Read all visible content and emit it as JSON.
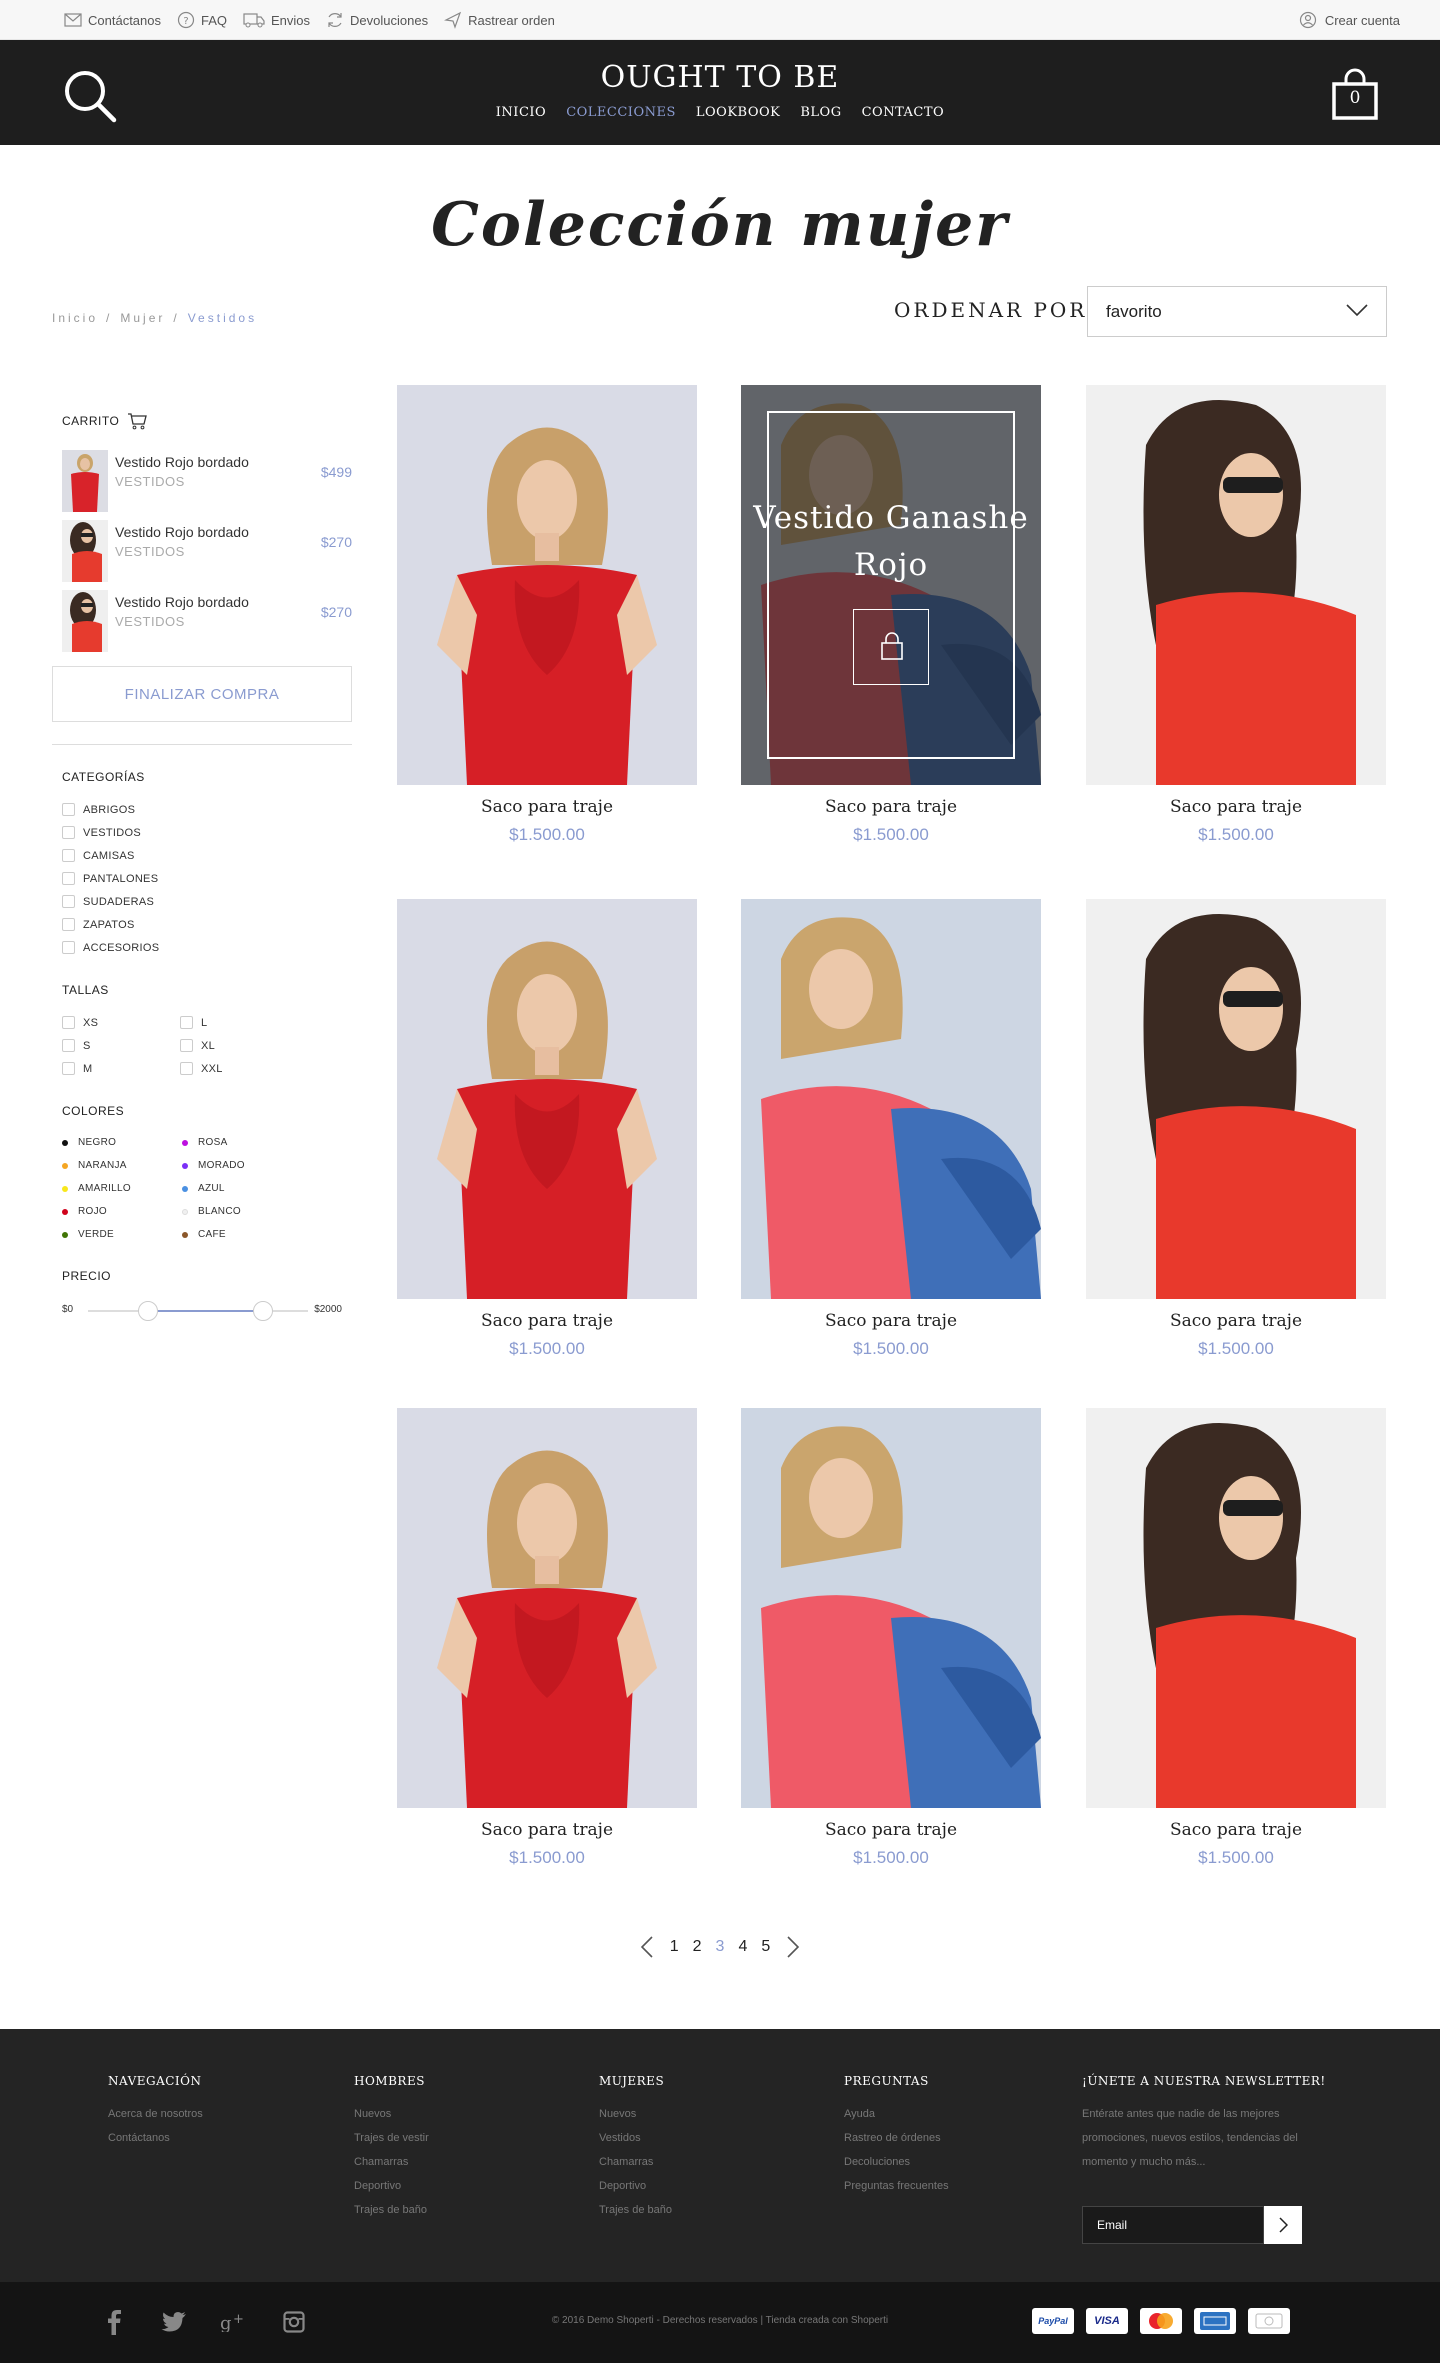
{
  "utilbar": {
    "links": [
      {
        "label": "Contáctanos",
        "icon": "mail-icon"
      },
      {
        "label": "FAQ",
        "icon": "help-icon"
      },
      {
        "label": "Envios",
        "icon": "truck-icon"
      },
      {
        "label": "Devoluciones",
        "icon": "refresh-icon"
      },
      {
        "label": "Rastrear orden",
        "icon": "send-icon"
      }
    ],
    "account_label": "Crear cuenta"
  },
  "header": {
    "logo": "OUGHT TO BE",
    "nav": [
      "INICIO",
      "COLECCIONES",
      "LOOKBOOK",
      "BLOG",
      "CONTACTO"
    ],
    "active_nav": "COLECCIONES",
    "cart_count": "0"
  },
  "page": {
    "title": "Colección mujer",
    "breadcrumb": [
      "Inicio",
      "/",
      "Mujer",
      "/",
      "Vestidos"
    ],
    "sort_label": "ORDENAR POR",
    "sort_value": "favorito"
  },
  "sidebar": {
    "cart_title": "CARRITO",
    "cart_items": [
      {
        "name": "Vestido Rojo bordado",
        "category": "VESTIDOS",
        "price": "$499"
      },
      {
        "name": "Vestido Rojo bordado",
        "category": "VESTIDOS",
        "price": "$270"
      },
      {
        "name": "Vestido Rojo bordado",
        "category": "VESTIDOS",
        "price": "$270"
      }
    ],
    "checkout_label": "FINALIZAR COMPRA",
    "categories_title": "CATEGORÍAS",
    "categories": [
      "ABRIGOS",
      "VESTIDOS",
      "CAMISAS",
      "PANTALONES",
      "SUDADERAS",
      "ZAPATOS",
      "ACCESORIOS"
    ],
    "sizes_title": "TALLAS",
    "sizes": [
      "XS",
      "S",
      "M",
      "L",
      "XL",
      "XXL"
    ],
    "colors_title": "COLORES",
    "colors": [
      {
        "name": "NEGRO",
        "hex": "#111111"
      },
      {
        "name": "NARANJA",
        "hex": "#f5a623"
      },
      {
        "name": "AMARILLO",
        "hex": "#f8e71c"
      },
      {
        "name": "ROJO",
        "hex": "#d0021b"
      },
      {
        "name": "VERDE",
        "hex": "#417505"
      },
      {
        "name": "ROSA",
        "hex": "#bd10e0"
      },
      {
        "name": "MORADO",
        "hex": "#7b2ff7"
      },
      {
        "name": "AZUL",
        "hex": "#4a90e2"
      },
      {
        "name": "BLANCO",
        "hex": "#eeeeee"
      },
      {
        "name": "CAFE",
        "hex": "#8b572a"
      }
    ],
    "price_title": "PRECIO",
    "price_min": "$0",
    "price_max": "$2000"
  },
  "products": [
    {
      "name": "Saco para traje",
      "price": "$1.500.00",
      "style": "red-dress"
    },
    {
      "name": "Saco para traje",
      "price": "$1.500.00",
      "style": "pink-jeans",
      "overlay_title": "Vestido Ganashe Rojo"
    },
    {
      "name": "Saco para traje",
      "price": "$1.500.00",
      "style": "red-blouse"
    },
    {
      "name": "Saco para traje",
      "price": "$1.500.00",
      "style": "red-dress"
    },
    {
      "name": "Saco para traje",
      "price": "$1.500.00",
      "style": "pink-jeans"
    },
    {
      "name": "Saco para traje",
      "price": "$1.500.00",
      "style": "red-blouse"
    },
    {
      "name": "Saco para traje",
      "price": "$1.500.00",
      "style": "red-dress"
    },
    {
      "name": "Saco para traje",
      "price": "$1.500.00",
      "style": "pink-jeans"
    },
    {
      "name": "Saco para traje",
      "price": "$1.500.00",
      "style": "red-blouse"
    }
  ],
  "pagination": {
    "pages": [
      "1",
      "2",
      "3",
      "4",
      "5"
    ],
    "current": "3"
  },
  "footer": {
    "columns": [
      {
        "title": "NAVEGACIÓN",
        "links": [
          "Acerca de nosotros",
          "Contáctanos"
        ]
      },
      {
        "title": "HOMBRES",
        "links": [
          "Nuevos",
          "Trajes de vestir",
          "Chamarras",
          "Deportivo",
          "Trajes de baño"
        ]
      },
      {
        "title": "MUJERES",
        "links": [
          "Nuevos",
          "Vestidos",
          "Chamarras",
          "Deportivo",
          "Trajes de baño"
        ]
      },
      {
        "title": "PREGUNTAS",
        "links": [
          "Ayuda",
          "Rastreo de órdenes",
          "Decoluciones",
          "Preguntas frecuentes"
        ]
      }
    ],
    "newsletter_title": "¡ÚNETE A NUESTRA NEWSLETTER!",
    "newsletter_text": "Entérate antes que nadie de las mejores promociones, nuevos estilos, tendencias del momento y mucho más...",
    "email_placeholder": "Email",
    "copyright": "© 2016 Demo Shoperti - Derechos reservados | Tienda creada con Shoperti",
    "payments": [
      "PayPal",
      "VISA",
      "",
      "",
      ""
    ]
  },
  "colors": {
    "accent": "#8a9bd0",
    "header_bg": "#1e1e1e",
    "footer_bg": "#242424"
  }
}
